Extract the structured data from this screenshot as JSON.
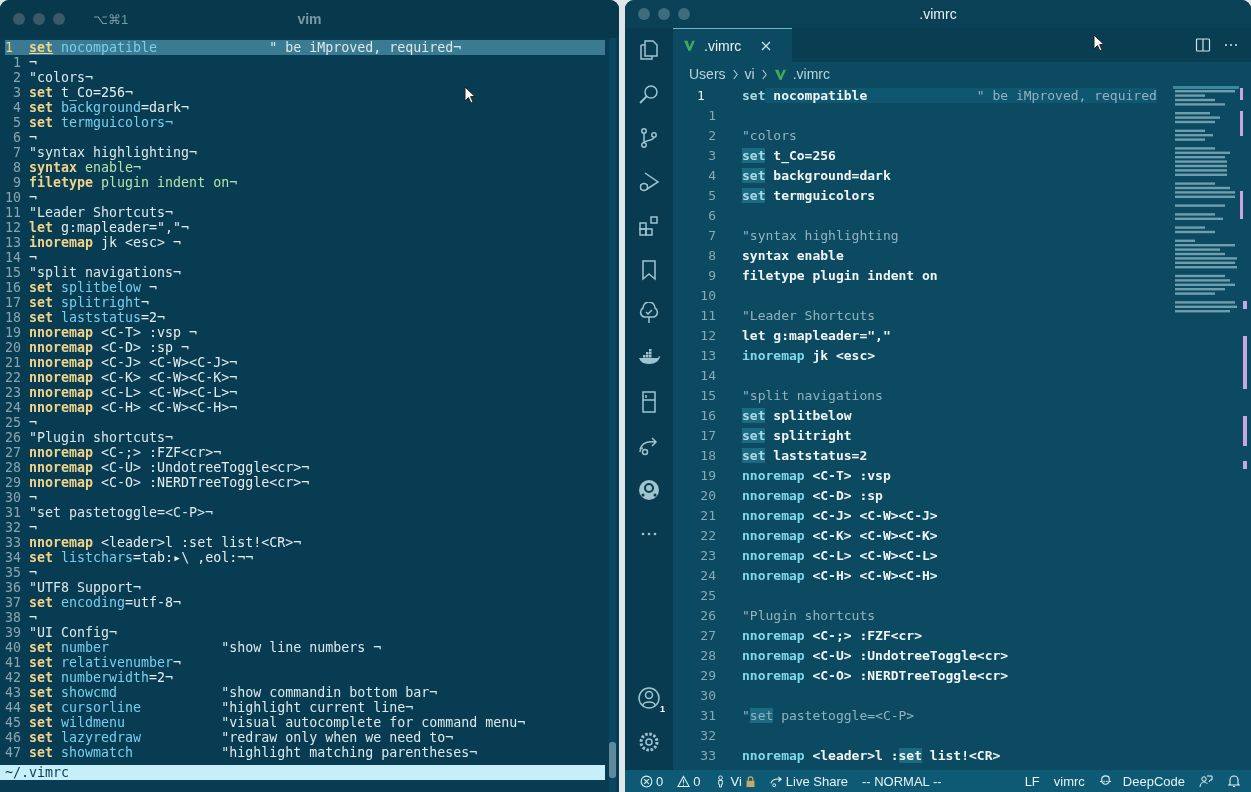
{
  "terminal": {
    "shortcut": "⌥⌘1",
    "title": "vim",
    "current_line": {
      "number": "1",
      "tokens": [
        {
          "text": "set",
          "kind": "keyword"
        },
        {
          "text": " nocompatible              ",
          "kind": "option"
        },
        {
          "text": "\" be iMproved, required¬",
          "kind": "comment"
        }
      ]
    },
    "lines": [
      {
        "number": "1",
        "tokens": [
          {
            "text": "¬",
            "kind": "plain"
          }
        ]
      },
      {
        "number": "2",
        "tokens": [
          {
            "text": "\"colors¬",
            "kind": "comment"
          }
        ]
      },
      {
        "number": "3",
        "tokens": [
          {
            "text": "set ",
            "kind": "keyword"
          },
          {
            "text": "t_Co=256¬",
            "kind": "plain"
          }
        ]
      },
      {
        "number": "4",
        "tokens": [
          {
            "text": "set ",
            "kind": "keyword"
          },
          {
            "text": "background",
            "kind": "option"
          },
          {
            "text": "=dark¬",
            "kind": "plain"
          }
        ]
      },
      {
        "number": "5",
        "tokens": [
          {
            "text": "set ",
            "kind": "keyword"
          },
          {
            "text": "termguicolors¬",
            "kind": "option"
          }
        ]
      },
      {
        "number": "6",
        "tokens": [
          {
            "text": "¬",
            "kind": "plain"
          }
        ]
      },
      {
        "number": "7",
        "tokens": [
          {
            "text": "\"syntax highlighting¬",
            "kind": "comment"
          }
        ]
      },
      {
        "number": "8",
        "tokens": [
          {
            "text": "syntax ",
            "kind": "keyword"
          },
          {
            "text": "enable¬",
            "kind": "arg"
          }
        ]
      },
      {
        "number": "9",
        "tokens": [
          {
            "text": "filetype ",
            "kind": "keyword"
          },
          {
            "text": "plugin indent on¬",
            "kind": "arg"
          }
        ]
      },
      {
        "number": "10",
        "tokens": [
          {
            "text": "¬",
            "kind": "plain"
          }
        ]
      },
      {
        "number": "11",
        "tokens": [
          {
            "text": "\"Leader Shortcuts¬",
            "kind": "comment"
          }
        ]
      },
      {
        "number": "12",
        "tokens": [
          {
            "text": "let ",
            "kind": "keyword"
          },
          {
            "text": "g:mapleader=\",\"¬",
            "kind": "plain"
          }
        ]
      },
      {
        "number": "13",
        "tokens": [
          {
            "text": "inoremap ",
            "kind": "keyword"
          },
          {
            "text": "jk <esc> ¬",
            "kind": "plain"
          }
        ]
      },
      {
        "number": "14",
        "tokens": [
          {
            "text": "¬",
            "kind": "plain"
          }
        ]
      },
      {
        "number": "15",
        "tokens": [
          {
            "text": "\"split navigations¬",
            "kind": "comment"
          }
        ]
      },
      {
        "number": "16",
        "tokens": [
          {
            "text": "set ",
            "kind": "keyword"
          },
          {
            "text": "splitbelow",
            "kind": "option"
          },
          {
            "text": " ¬",
            "kind": "plain"
          }
        ]
      },
      {
        "number": "17",
        "tokens": [
          {
            "text": "set ",
            "kind": "keyword"
          },
          {
            "text": "splitright",
            "kind": "option"
          },
          {
            "text": "¬",
            "kind": "plain"
          }
        ]
      },
      {
        "number": "18",
        "tokens": [
          {
            "text": "set ",
            "kind": "keyword"
          },
          {
            "text": "laststatus",
            "kind": "option"
          },
          {
            "text": "=2¬",
            "kind": "plain"
          }
        ]
      },
      {
        "number": "19",
        "tokens": [
          {
            "text": "nnoremap ",
            "kind": "keyword"
          },
          {
            "text": "<C-T> :vsp ¬",
            "kind": "plain"
          }
        ]
      },
      {
        "number": "20",
        "tokens": [
          {
            "text": "nnoremap ",
            "kind": "keyword"
          },
          {
            "text": "<C-D> :sp ¬",
            "kind": "plain"
          }
        ]
      },
      {
        "number": "21",
        "tokens": [
          {
            "text": "nnoremap ",
            "kind": "keyword"
          },
          {
            "text": "<C-J> <C-W><C-J>¬",
            "kind": "plain"
          }
        ]
      },
      {
        "number": "22",
        "tokens": [
          {
            "text": "nnoremap ",
            "kind": "keyword"
          },
          {
            "text": "<C-K> <C-W><C-K>¬",
            "kind": "plain"
          }
        ]
      },
      {
        "number": "23",
        "tokens": [
          {
            "text": "nnoremap ",
            "kind": "keyword"
          },
          {
            "text": "<C-L> <C-W><C-L>¬",
            "kind": "plain"
          }
        ]
      },
      {
        "number": "24",
        "tokens": [
          {
            "text": "nnoremap ",
            "kind": "keyword"
          },
          {
            "text": "<C-H> <C-W><C-H>¬",
            "kind": "plain"
          }
        ]
      },
      {
        "number": "25",
        "tokens": [
          {
            "text": "¬",
            "kind": "plain"
          }
        ]
      },
      {
        "number": "26",
        "tokens": [
          {
            "text": "\"Plugin shortcuts¬",
            "kind": "comment"
          }
        ]
      },
      {
        "number": "27",
        "tokens": [
          {
            "text": "nnoremap ",
            "kind": "keyword"
          },
          {
            "text": "<C-;> :FZF<cr>¬",
            "kind": "plain"
          }
        ]
      },
      {
        "number": "28",
        "tokens": [
          {
            "text": "nnoremap ",
            "kind": "keyword"
          },
          {
            "text": "<C-U> :UndotreeToggle<cr>¬",
            "kind": "plain"
          }
        ]
      },
      {
        "number": "29",
        "tokens": [
          {
            "text": "nnoremap ",
            "kind": "keyword"
          },
          {
            "text": "<C-O> :NERDTreeToggle<cr>¬",
            "kind": "plain"
          }
        ]
      },
      {
        "number": "30",
        "tokens": [
          {
            "text": "¬",
            "kind": "plain"
          }
        ]
      },
      {
        "number": "31",
        "tokens": [
          {
            "text": "\"set pastetoggle=<C-P>¬",
            "kind": "comment"
          }
        ]
      },
      {
        "number": "32",
        "tokens": [
          {
            "text": "¬",
            "kind": "plain"
          }
        ]
      },
      {
        "number": "33",
        "tokens": [
          {
            "text": "nnoremap ",
            "kind": "keyword"
          },
          {
            "text": "<leader>l :set list!<CR>¬",
            "kind": "plain"
          }
        ]
      },
      {
        "number": "34",
        "tokens": [
          {
            "text": "set ",
            "kind": "keyword"
          },
          {
            "text": "listchars",
            "kind": "option"
          },
          {
            "text": "=tab:▸\\ ,eol:¬¬",
            "kind": "plain"
          }
        ]
      },
      {
        "number": "35",
        "tokens": [
          {
            "text": "¬",
            "kind": "plain"
          }
        ]
      },
      {
        "number": "36",
        "tokens": [
          {
            "text": "\"UTF8 Support¬",
            "kind": "comment"
          }
        ]
      },
      {
        "number": "37",
        "tokens": [
          {
            "text": "set ",
            "kind": "keyword"
          },
          {
            "text": "encoding",
            "kind": "option"
          },
          {
            "text": "=utf-8¬",
            "kind": "plain"
          }
        ]
      },
      {
        "number": "38",
        "tokens": [
          {
            "text": "¬",
            "kind": "plain"
          }
        ]
      },
      {
        "number": "39",
        "tokens": [
          {
            "text": "\"UI Config¬",
            "kind": "comment"
          }
        ]
      },
      {
        "number": "40",
        "tokens": [
          {
            "text": "set ",
            "kind": "keyword"
          },
          {
            "text": "number              ",
            "kind": "option"
          },
          {
            "text": "\"show line numbers ¬",
            "kind": "comment"
          }
        ]
      },
      {
        "number": "41",
        "tokens": [
          {
            "text": "set ",
            "kind": "keyword"
          },
          {
            "text": "relativenumber",
            "kind": "option"
          },
          {
            "text": "¬",
            "kind": "plain"
          }
        ]
      },
      {
        "number": "42",
        "tokens": [
          {
            "text": "set ",
            "kind": "keyword"
          },
          {
            "text": "numberwidth",
            "kind": "option"
          },
          {
            "text": "=2¬",
            "kind": "plain"
          }
        ]
      },
      {
        "number": "43",
        "tokens": [
          {
            "text": "set ",
            "kind": "keyword"
          },
          {
            "text": "showcmd             ",
            "kind": "option"
          },
          {
            "text": "\"show commandin bottom bar¬",
            "kind": "comment"
          }
        ]
      },
      {
        "number": "44",
        "tokens": [
          {
            "text": "set ",
            "kind": "keyword"
          },
          {
            "text": "cursorline          ",
            "kind": "option"
          },
          {
            "text": "\"highlight current line¬",
            "kind": "comment"
          }
        ]
      },
      {
        "number": "45",
        "tokens": [
          {
            "text": "set ",
            "kind": "keyword"
          },
          {
            "text": "wildmenu            ",
            "kind": "option"
          },
          {
            "text": "\"visual autocomplete for command menu¬",
            "kind": "comment"
          }
        ]
      },
      {
        "number": "46",
        "tokens": [
          {
            "text": "set ",
            "kind": "keyword"
          },
          {
            "text": "lazyredraw          ",
            "kind": "option"
          },
          {
            "text": "\"redraw only when we need to¬",
            "kind": "comment"
          }
        ]
      },
      {
        "number": "47",
        "tokens": [
          {
            "text": "set ",
            "kind": "keyword"
          },
          {
            "text": "showmatch           ",
            "kind": "option"
          },
          {
            "text": "\"highlight matching parentheses¬",
            "kind": "comment"
          }
        ]
      }
    ],
    "status_line": "~/.vimrc"
  },
  "editor": {
    "title": ".vimrc",
    "tabs": [
      {
        "label": ".vimrc",
        "selected": true
      }
    ],
    "breadcrumb": [
      "Users",
      "vi",
      ".vimrc"
    ],
    "account_badge": "1",
    "current_line": {
      "number": "1",
      "tokens": [
        {
          "text": "set",
          "kind": "keyword",
          "highlighted": false
        },
        {
          "text": " nocompatible              ",
          "kind": "text",
          "highlighted": true
        },
        {
          "text": "\" be iMproved, required",
          "kind": "comment",
          "highlighted": true
        }
      ]
    },
    "lines": [
      {
        "number": "1"
      },
      {
        "number": "2",
        "tokens": [
          {
            "text": "\"colors",
            "kind": "comment",
            "highlighted": false
          }
        ]
      },
      {
        "number": "3",
        "tokens": [
          {
            "text": "set",
            "kind": "keyword",
            "highlighted": true
          },
          {
            "text": " t_Co=256",
            "kind": "text",
            "highlighted": false
          }
        ]
      },
      {
        "number": "4",
        "tokens": [
          {
            "text": "set",
            "kind": "keyword",
            "highlighted": true
          },
          {
            "text": " background=dark",
            "kind": "text",
            "highlighted": false
          }
        ]
      },
      {
        "number": "5",
        "tokens": [
          {
            "text": "set",
            "kind": "keyword",
            "highlighted": true
          },
          {
            "text": " termguicolors",
            "kind": "text",
            "highlighted": false
          }
        ]
      },
      {
        "number": "6"
      },
      {
        "number": "7",
        "tokens": [
          {
            "text": "\"syntax highlighting",
            "kind": "comment",
            "highlighted": false
          }
        ]
      },
      {
        "number": "8",
        "tokens": [
          {
            "text": "syntax enable",
            "kind": "text",
            "highlighted": false
          }
        ]
      },
      {
        "number": "9",
        "tokens": [
          {
            "text": "filetype plugin indent on",
            "kind": "text",
            "highlighted": false
          }
        ]
      },
      {
        "number": "10"
      },
      {
        "number": "11",
        "tokens": [
          {
            "text": "\"Leader Shortcuts",
            "kind": "comment",
            "highlighted": false
          }
        ]
      },
      {
        "number": "12",
        "tokens": [
          {
            "text": "let g:mapleader=\",\"",
            "kind": "text",
            "highlighted": false
          }
        ]
      },
      {
        "number": "13",
        "tokens": [
          {
            "text": "inoremap",
            "kind": "command",
            "highlighted": false
          },
          {
            "text": " jk <esc>",
            "kind": "text",
            "highlighted": false
          }
        ]
      },
      {
        "number": "14"
      },
      {
        "number": "15",
        "tokens": [
          {
            "text": "\"split navigations",
            "kind": "comment",
            "highlighted": false
          }
        ]
      },
      {
        "number": "16",
        "tokens": [
          {
            "text": "set",
            "kind": "keyword",
            "highlighted": true
          },
          {
            "text": " splitbelow",
            "kind": "text",
            "highlighted": false
          }
        ]
      },
      {
        "number": "17",
        "tokens": [
          {
            "text": "set",
            "kind": "keyword",
            "highlighted": true
          },
          {
            "text": " splitright",
            "kind": "text",
            "highlighted": false
          }
        ]
      },
      {
        "number": "18",
        "tokens": [
          {
            "text": "set",
            "kind": "keyword",
            "highlighted": true
          },
          {
            "text": " laststatus=2",
            "kind": "text",
            "highlighted": false
          }
        ]
      },
      {
        "number": "19",
        "tokens": [
          {
            "text": "nnoremap",
            "kind": "command",
            "highlighted": false
          },
          {
            "text": " <C-T> :vsp",
            "kind": "text",
            "highlighted": false
          }
        ]
      },
      {
        "number": "20",
        "tokens": [
          {
            "text": "nnoremap",
            "kind": "command",
            "highlighted": false
          },
          {
            "text": " <C-D> :sp",
            "kind": "text",
            "highlighted": false
          }
        ]
      },
      {
        "number": "21",
        "tokens": [
          {
            "text": "nnoremap",
            "kind": "command",
            "highlighted": false
          },
          {
            "text": " <C-J> <C-W><C-J>",
            "kind": "text",
            "highlighted": false
          }
        ]
      },
      {
        "number": "22",
        "tokens": [
          {
            "text": "nnoremap",
            "kind": "command",
            "highlighted": false
          },
          {
            "text": " <C-K> <C-W><C-K>",
            "kind": "text",
            "highlighted": false
          }
        ]
      },
      {
        "number": "23",
        "tokens": [
          {
            "text": "nnoremap",
            "kind": "command",
            "highlighted": false
          },
          {
            "text": " <C-L> <C-W><C-L>",
            "kind": "text",
            "highlighted": false
          }
        ]
      },
      {
        "number": "24",
        "tokens": [
          {
            "text": "nnoremap",
            "kind": "command",
            "highlighted": false
          },
          {
            "text": " <C-H> <C-W><C-H>",
            "kind": "text",
            "highlighted": false
          }
        ]
      },
      {
        "number": "25"
      },
      {
        "number": "26",
        "tokens": [
          {
            "text": "\"Plugin shortcuts",
            "kind": "comment",
            "highlighted": false
          }
        ]
      },
      {
        "number": "27",
        "tokens": [
          {
            "text": "nnoremap",
            "kind": "command",
            "highlighted": false
          },
          {
            "text": " <C-;> :FZF<cr>",
            "kind": "text",
            "highlighted": false
          }
        ]
      },
      {
        "number": "28",
        "tokens": [
          {
            "text": "nnoremap",
            "kind": "command",
            "highlighted": false
          },
          {
            "text": " <C-U> :UndotreeToggle<cr>",
            "kind": "text",
            "highlighted": false
          }
        ]
      },
      {
        "number": "29",
        "tokens": [
          {
            "text": "nnoremap",
            "kind": "command",
            "highlighted": false
          },
          {
            "text": " <C-O> :NERDTreeToggle<cr>",
            "kind": "text",
            "highlighted": false
          }
        ]
      },
      {
        "number": "30"
      },
      {
        "number": "31",
        "tokens": [
          {
            "text": "\"",
            "kind": "comment",
            "highlighted": false
          },
          {
            "text": "set",
            "kind": "comment",
            "highlighted": true
          },
          {
            "text": " pastetoggle=<C-P>",
            "kind": "comment",
            "highlighted": false
          }
        ]
      },
      {
        "number": "32"
      },
      {
        "number": "33",
        "tokens": [
          {
            "text": "nnoremap",
            "kind": "command",
            "highlighted": false
          },
          {
            "text": " <leader>l :",
            "kind": "text",
            "highlighted": false
          },
          {
            "text": "set",
            "kind": "text",
            "highlighted": true
          },
          {
            "text": " list!<CR>",
            "kind": "text",
            "highlighted": false
          }
        ]
      }
    ],
    "status_bar": {
      "left": [
        {
          "kind": "errors",
          "text": "0"
        },
        {
          "kind": "warnings",
          "text": "0"
        },
        {
          "kind": "vim-user",
          "text": "Vi"
        },
        {
          "kind": "live-share",
          "text": "Live Share"
        },
        {
          "kind": "mode",
          "text": "-- NORMAL --"
        }
      ],
      "right": [
        {
          "kind": "plain",
          "text": "LF"
        },
        {
          "kind": "plain",
          "text": "vimrc"
        },
        {
          "kind": "deepcode",
          "text": "DeepCode"
        },
        {
          "kind": "feedback"
        },
        {
          "kind": "notifications"
        }
      ]
    }
  }
}
